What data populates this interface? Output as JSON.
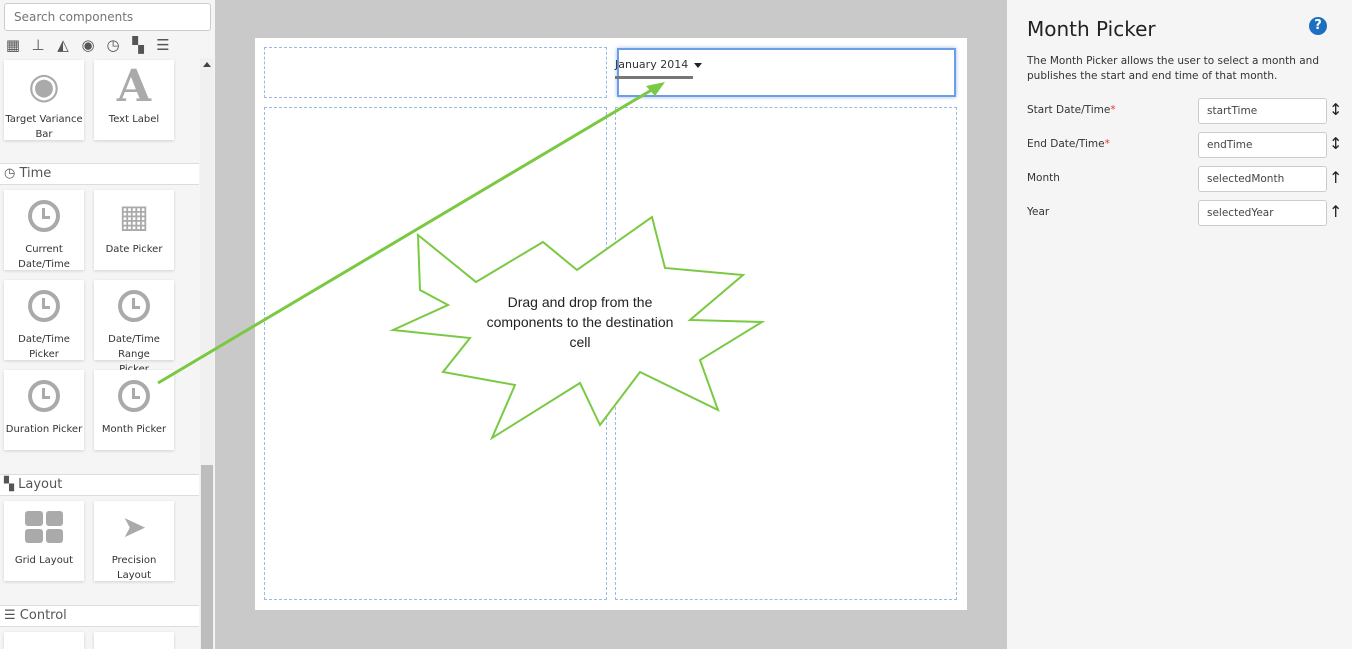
{
  "sidebar": {
    "search_placeholder": "Search components",
    "tiles_top": [
      "Target Variance Bar",
      "Text Label"
    ],
    "sections": [
      {
        "title": "Time",
        "tiles": [
          "Current Date/Time",
          "Date Picker",
          "Date/Time Picker",
          "Date/Time Range Picker",
          "Duration Picker",
          "Month Picker"
        ]
      },
      {
        "title": "Layout",
        "tiles": [
          "Grid Layout",
          "Precision Layout"
        ]
      },
      {
        "title": "Control",
        "tiles": []
      }
    ]
  },
  "canvas": {
    "month_value": "January 2014",
    "callout": "Drag and drop from the components to the destination cell",
    "accent": "#7ac943"
  },
  "panel": {
    "title": "Month Picker",
    "help": "?",
    "description": "The Month Picker allows the user to select a month and publishes the start and end time of that month.",
    "fields": [
      {
        "label": "Start Date/Time",
        "required": "*",
        "value": "startTime",
        "dir": "↕"
      },
      {
        "label": "End Date/Time",
        "required": "*",
        "value": "endTime",
        "dir": "↕"
      },
      {
        "label": "Month",
        "required": "",
        "value": "selectedMonth",
        "dir": "↑"
      },
      {
        "label": "Year",
        "required": "",
        "value": "selectedYear",
        "dir": "↑"
      }
    ]
  }
}
